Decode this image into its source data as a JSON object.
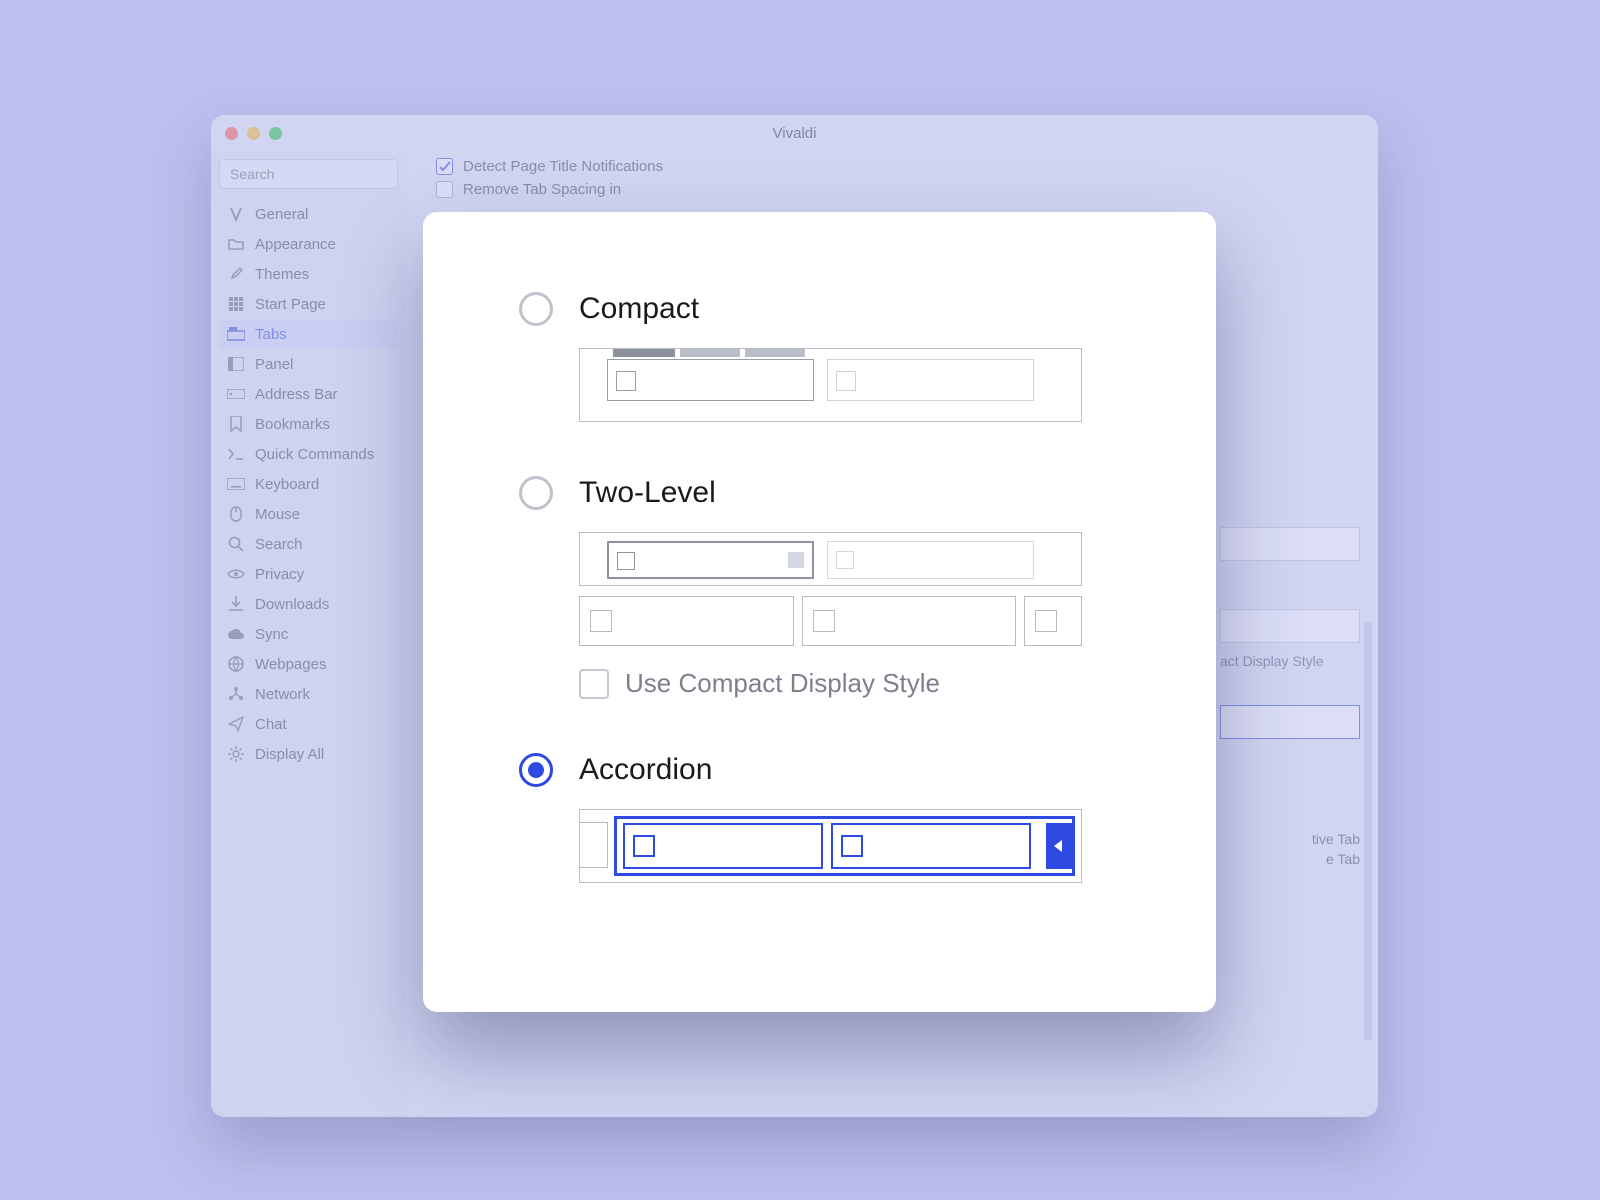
{
  "window": {
    "title": "Vivaldi"
  },
  "sidebar": {
    "search_placeholder": "Search",
    "items": [
      {
        "label": "General"
      },
      {
        "label": "Appearance"
      },
      {
        "label": "Themes"
      },
      {
        "label": "Start Page"
      },
      {
        "label": "Tabs",
        "active": true
      },
      {
        "label": "Panel"
      },
      {
        "label": "Address Bar"
      },
      {
        "label": "Bookmarks"
      },
      {
        "label": "Quick Commands"
      },
      {
        "label": "Keyboard"
      },
      {
        "label": "Mouse"
      },
      {
        "label": "Search"
      },
      {
        "label": "Privacy"
      },
      {
        "label": "Downloads"
      },
      {
        "label": "Sync"
      },
      {
        "label": "Webpages"
      },
      {
        "label": "Network"
      },
      {
        "label": "Chat"
      },
      {
        "label": "Display All"
      }
    ]
  },
  "content": {
    "detect_title": "Detect Page Title Notifications",
    "remove_spacing": "Remove Tab Spacing in",
    "bg_compact_display": "act Display Style",
    "bg_active_tab": "tive Tab",
    "bg_e_tab": "e Tab"
  },
  "modal": {
    "options": {
      "compact": "Compact",
      "two_level": "Two-Level",
      "accordion": "Accordion"
    },
    "use_compact_display": "Use Compact Display Style",
    "selected": "accordion"
  }
}
